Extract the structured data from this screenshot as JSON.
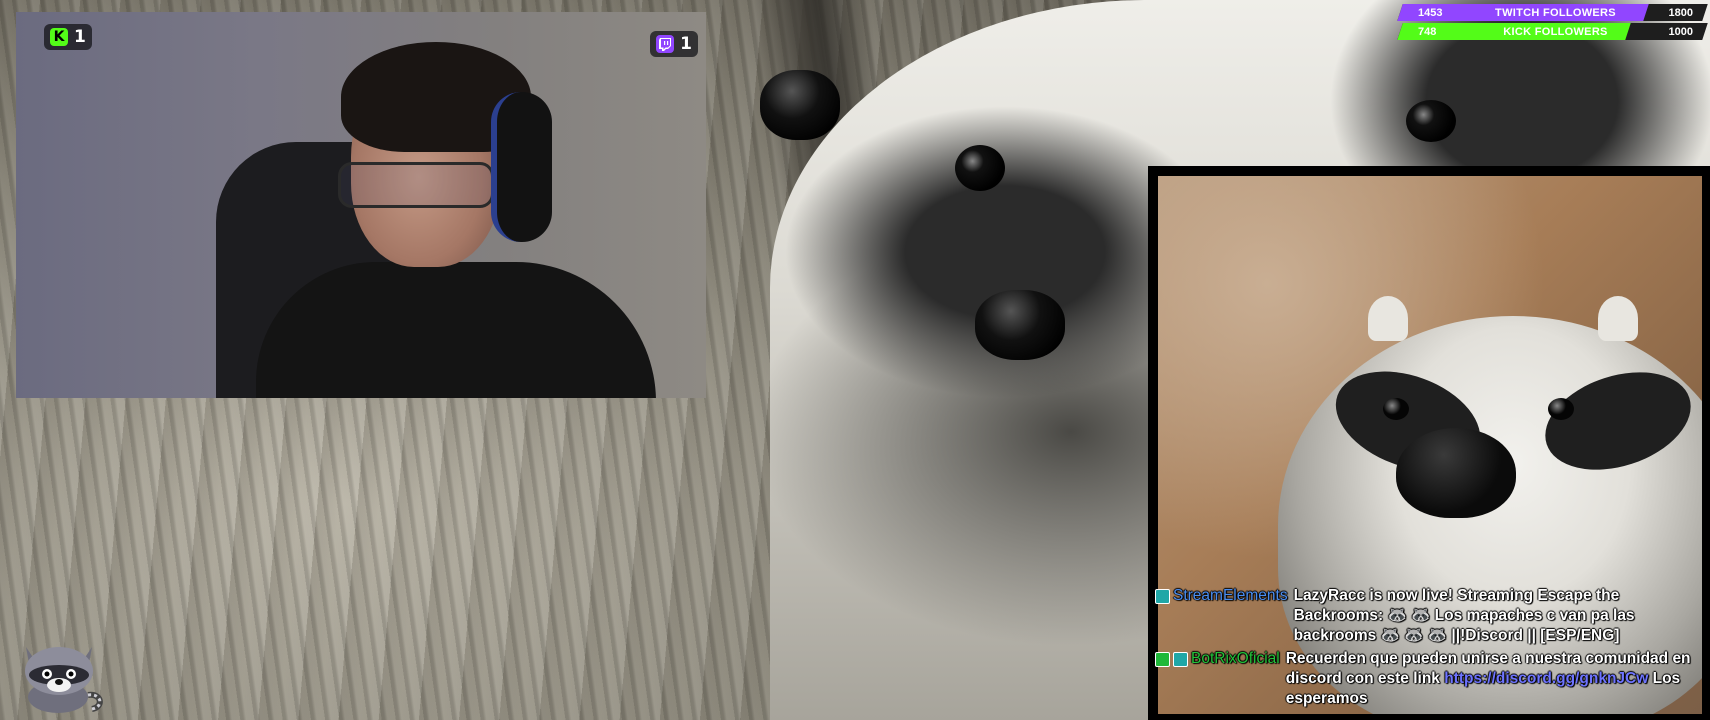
{
  "stream_overlay": {
    "kick_viewers": "1",
    "twitch_viewers": "1"
  },
  "follower_goals": [
    {
      "id": "twitch",
      "current": "1453",
      "label": "TWITCH FOLLOWERS",
      "target": "1800",
      "progress_fraction": 0.807,
      "color": "#9146ff"
    },
    {
      "id": "kick",
      "current": "748",
      "label": "KICK FOLLOWERS",
      "target": "1000",
      "progress_fraction": 0.748,
      "color": "#53fc18"
    }
  ],
  "chat": {
    "messages": [
      {
        "user": "StreamElements",
        "user_color": "#4a8df0",
        "badges": [
          "bot-badge"
        ],
        "text": "LazyRacc is now live! Streaming Escape the Backrooms: 🦝 🦝 Los mapaches c van pa las backrooms 🦝 🦝 🦝 ||!Discord || [ESP/ENG]"
      },
      {
        "user": "BotRixOficial",
        "user_color": "#22c33a",
        "badges": [
          "moderator-badge",
          "bot-badge"
        ],
        "text": "Recuerden que pueden unirse a nuestra comunidad en discord con este link",
        "link": "https://discord.gg/gnknJCw",
        "text_after": "Los esperamos"
      }
    ]
  },
  "icons": {
    "kick": "kick-logo-icon",
    "twitch": "twitch-logo-icon",
    "mascot": "raccoon-mascot-icon"
  },
  "colors": {
    "kick_green": "#53fc18",
    "twitch_purple": "#9146ff",
    "link_blue": "#6e74ff"
  }
}
